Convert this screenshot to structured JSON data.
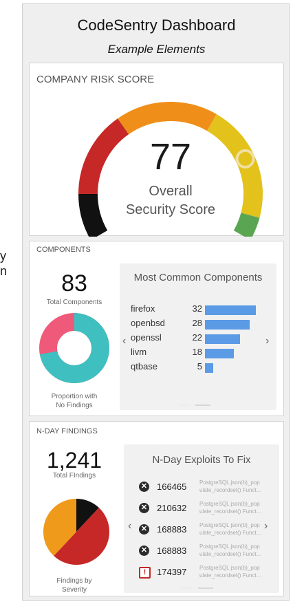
{
  "dashboard": {
    "title": "CodeSentry Dashboard",
    "subtitle": "Example Elements"
  },
  "edge_text": [
    "y",
    "n"
  ],
  "risk": {
    "title": "COMPANY RISK SCORE",
    "score": "77",
    "label_line1": "Overall",
    "label_line2": "Security Score",
    "score_fraction": 0.77,
    "gauge_colors": [
      "#111111",
      "#c62828",
      "#ef8f1a",
      "#e3c21b",
      "#5aa552"
    ],
    "marker_color": "#e3c21b"
  },
  "components": {
    "title": "COMPONENTS",
    "total": "83",
    "total_label": "Total Components",
    "donut_label_line1": "Proportion with",
    "donut_label_line2": "No Findings",
    "donut_colors": {
      "findings": "#ef5a7a",
      "no_findings": "#3fbfbf"
    },
    "no_findings_fraction": 0.72,
    "chart_title": "Most Common Components",
    "prev_arrow": "‹",
    "next_arrow": "›",
    "items": [
      {
        "name": "firefox",
        "value": "32"
      },
      {
        "name": "openbsd",
        "value": "28"
      },
      {
        "name": "openssl",
        "value": "22"
      },
      {
        "name": "livm",
        "value": "18"
      },
      {
        "name": "qtbase",
        "value": "5"
      }
    ]
  },
  "nday": {
    "title": "N-DAY FINDINGS",
    "total": "1,241",
    "total_label": "Total FIndings",
    "pie_label_line1": "Findings by",
    "pie_label_line2": "Severity",
    "pie_slices": [
      {
        "value": 0.12,
        "color": "#111111"
      },
      {
        "value": 0.5,
        "color": "#c62828"
      },
      {
        "value": 0.38,
        "color": "#ef9a1a"
      }
    ],
    "list_title": "N-Day Exploits To Fix",
    "prev_arrow": "‹",
    "next_arrow": "›",
    "exploits": [
      {
        "icon": "x-circle-icon",
        "glyph": "✕",
        "id": "166465",
        "desc": "PostgreSQL json(b)_pop ulate_recordset() Funct..."
      },
      {
        "icon": "x-circle-icon",
        "glyph": "✕",
        "id": "210632",
        "desc": "PostgreSQL json(b)_pop ulate_recordset() Funct..."
      },
      {
        "icon": "x-circle-icon",
        "glyph": "✕",
        "id": "168883",
        "desc": "PostgreSQL json(b)_pop ulate_recordset() Funct..."
      },
      {
        "icon": "x-circle-icon",
        "glyph": "✕",
        "id": "168883",
        "desc": "PostgreSQL json(b)_pop ulate_recordset() Funct..."
      },
      {
        "icon": "warning-square-icon",
        "glyph": "!",
        "id": "174397",
        "desc": "PostgreSQL json(b)_pop ulate_recordset() Funct..."
      }
    ]
  },
  "chart_data": [
    {
      "type": "bar",
      "title": "Most Common Components",
      "categories": [
        "firefox",
        "openbsd",
        "openssl",
        "livm",
        "qtbase"
      ],
      "values": [
        32,
        28,
        22,
        18,
        5
      ]
    }
  ]
}
